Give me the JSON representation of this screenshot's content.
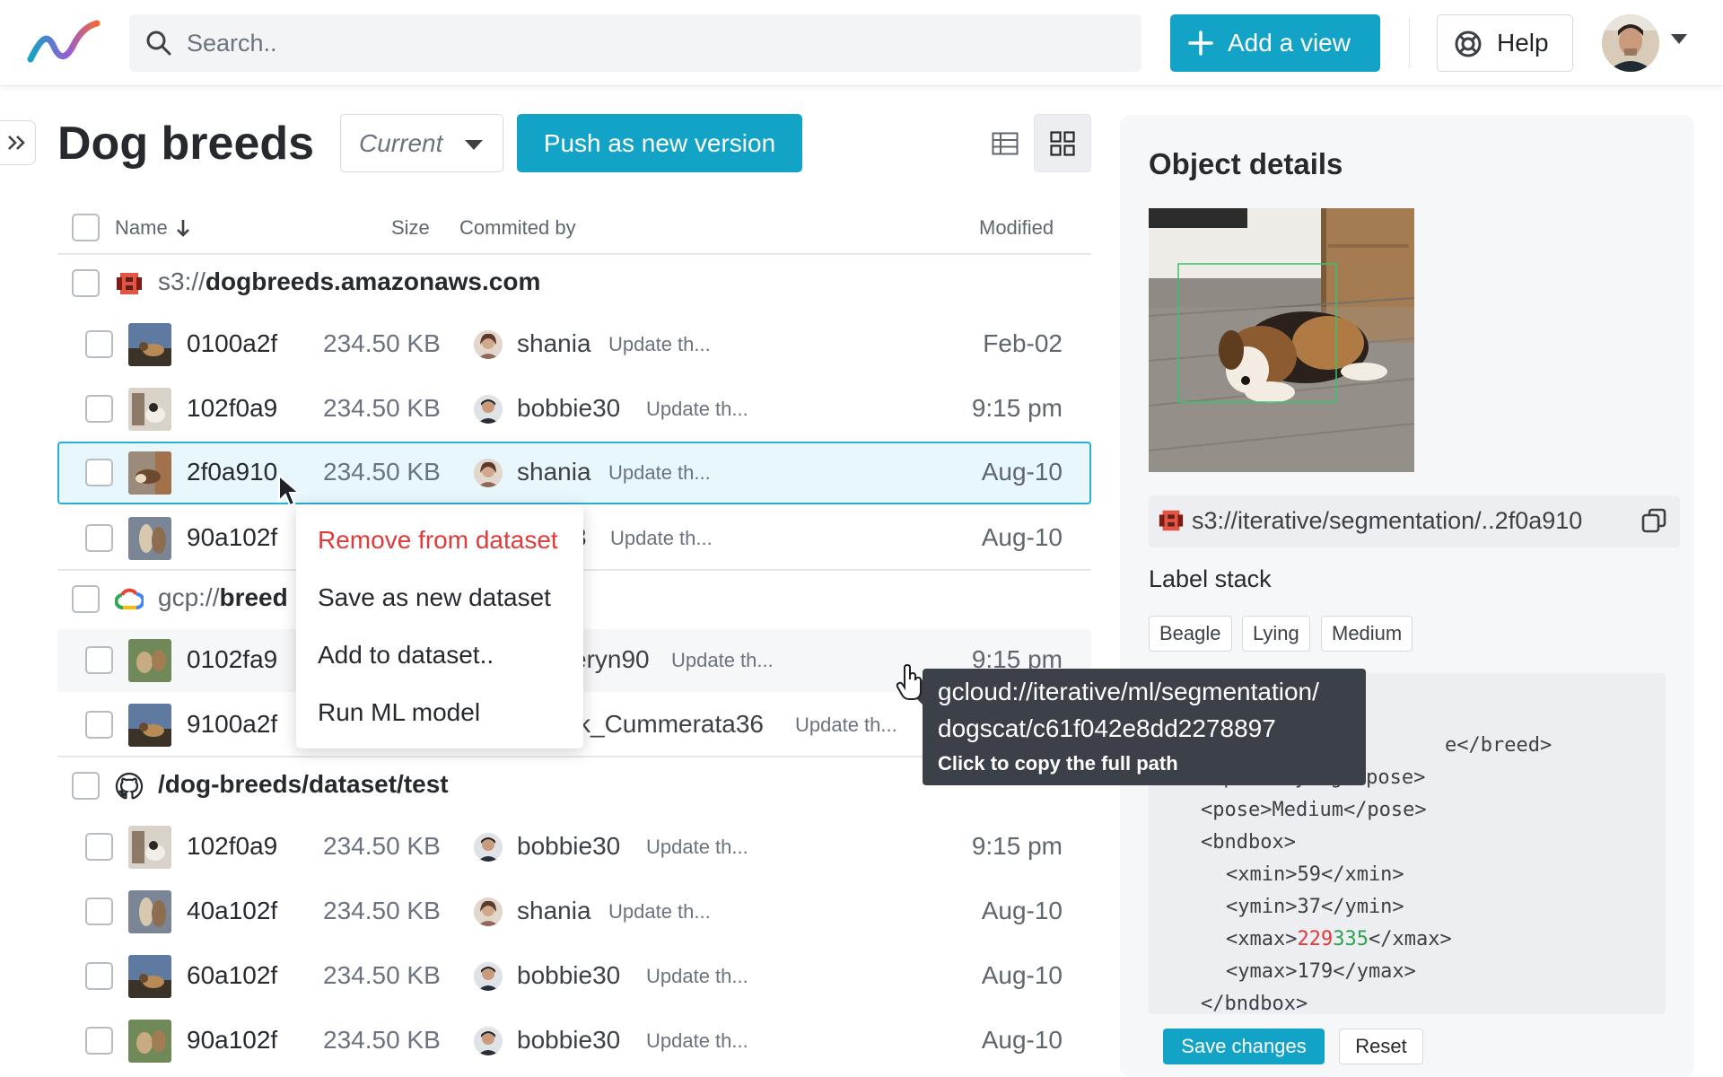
{
  "header": {
    "search_placeholder": "Search..",
    "add_view_label": "Add a view",
    "help_label": "Help",
    "logo_icon": "wave-logo-icon",
    "accent_color": "#13a3c7"
  },
  "toolbar": {
    "title": "Dog breeds",
    "version_select": "Current",
    "push_label": "Push as new version",
    "view_modes": [
      "table-view-icon",
      "grid-view-icon"
    ],
    "active_view": "grid"
  },
  "table": {
    "columns": {
      "name": "Name",
      "size": "Size",
      "committed_by": "Commited by",
      "modified": "Modified"
    },
    "sort_icon": "arrow-down-icon",
    "groups": [
      {
        "prefix": "s3://",
        "name": "dogbreeds.amazonaws.com",
        "icon": "aws-s3-icon",
        "rows": [
          {
            "name": "0100a2f",
            "size": "234.50 KB",
            "user": "shania",
            "msg": "Update th...",
            "modified": "Feb-02"
          },
          {
            "name": "102f0a9",
            "size": "234.50 KB",
            "user": "bobbie30",
            "msg": "Update th...",
            "modified": "9:15 pm"
          },
          {
            "name": "2f0a910",
            "size": "234.50 KB",
            "user": "shania",
            "msg": "Update th...",
            "modified": "Aug-10"
          },
          {
            "name": "90a102f",
            "size": "",
            "user": "3",
            "msg": "Update th...",
            "modified": "Aug-10"
          }
        ]
      },
      {
        "prefix": "gcp://",
        "name": "breed",
        "icon": "google-cloud-icon",
        "rows": [
          {
            "name": "0102fa9",
            "size": "",
            "user": "eryn90",
            "msg": "Update th...",
            "modified": "9:15 pm"
          },
          {
            "name": "9100a2f",
            "size": "",
            "user": "k_Cummerata36",
            "msg": "Update th...",
            "modified": ""
          }
        ]
      },
      {
        "prefix": "",
        "name": "/dog-breeds/dataset/test",
        "icon": "github-icon",
        "rows": [
          {
            "name": "102f0a9",
            "size": "234.50 KB",
            "user": "bobbie30",
            "msg": "Update th...",
            "modified": "9:15 pm"
          },
          {
            "name": "40a102f",
            "size": "234.50 KB",
            "user": "shania",
            "msg": "Update th...",
            "modified": "Aug-10"
          },
          {
            "name": "60a102f",
            "size": "234.50 KB",
            "user": "bobbie30",
            "msg": "Update th...",
            "modified": "Aug-10"
          },
          {
            "name": "90a102f",
            "size": "234.50 KB",
            "user": "bobbie30",
            "msg": "Update th...",
            "modified": "Aug-10"
          }
        ]
      }
    ]
  },
  "context_menu": {
    "items": [
      "Remove from dataset",
      "Save as new dataset",
      "Add to dataset..",
      "Run ML model"
    ],
    "danger_color": "#e03b3b"
  },
  "tooltip": {
    "line1": "gcloud://iterative/ml/segmentation/",
    "line2": "dogscat/c61f042e8dd2278897",
    "hint": "Click to copy the full path"
  },
  "details": {
    "title": "Object details",
    "path": "s3://iterative/segmentation/..2f0a910",
    "label_stack_title": "Label stack",
    "tags": [
      "Beagle",
      "Lying",
      "Medium"
    ],
    "code": {
      "l1": "e</breed>",
      "l2": "<pose>Lying</pose>",
      "l3": "<pose>Medium</pose>",
      "l4": "<bndbox>",
      "l5": "<xmin>59</xmin>",
      "l6": "<ymin>37</ymin>",
      "l7_open": "<xmax>",
      "l7_old": "229",
      "l7_new": "335",
      "l7_close": "</xmax>",
      "l8": "<ymax>179</ymax>",
      "l9": "</bndbox>"
    },
    "save_label": "Save changes",
    "reset_label": "Reset"
  }
}
